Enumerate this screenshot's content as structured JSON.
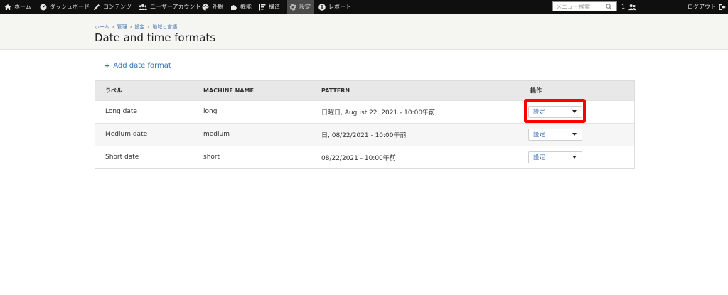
{
  "toolbar": {
    "items": [
      {
        "label": "ホーム",
        "icon": "home-icon"
      },
      {
        "label": "ダッシュボード",
        "icon": "dashboard-icon"
      },
      {
        "label": "コンテンツ",
        "icon": "pencil-icon"
      },
      {
        "label": "ユーザーアカウント",
        "icon": "users-icon"
      },
      {
        "label": "外観",
        "icon": "palette-icon"
      },
      {
        "label": "機能",
        "icon": "puzzle-icon"
      },
      {
        "label": "構造",
        "icon": "structure-icon"
      },
      {
        "label": "設定",
        "icon": "gear-icon",
        "active": true
      },
      {
        "label": "レポート",
        "icon": "info-icon"
      }
    ],
    "search_placeholder": "メニュー検索",
    "user_count": "1",
    "logout_label": "ログアウト"
  },
  "breadcrumb": [
    "ホーム",
    "管理",
    "設定",
    "地域と言語"
  ],
  "page_title": "Date and time formats",
  "add_link": "Add date format",
  "table": {
    "headers": [
      "ラベル",
      "MACHINE NAME",
      "PATTERN",
      "操作"
    ],
    "rows": [
      {
        "label": "Long date",
        "machine": "long",
        "pattern": "日曜日, August 22, 2021 - 10:00午前",
        "op": "設定"
      },
      {
        "label": "Medium date",
        "machine": "medium",
        "pattern": "日, 08/22/2021 - 10:00午前",
        "op": "設定"
      },
      {
        "label": "Short date",
        "machine": "short",
        "pattern": "08/22/2021 - 10:00午前",
        "op": "設定"
      }
    ]
  },
  "colors": {
    "accent": "#3a6fb3",
    "highlight": "#ff0000",
    "toolbar": "#0f0f0f"
  }
}
